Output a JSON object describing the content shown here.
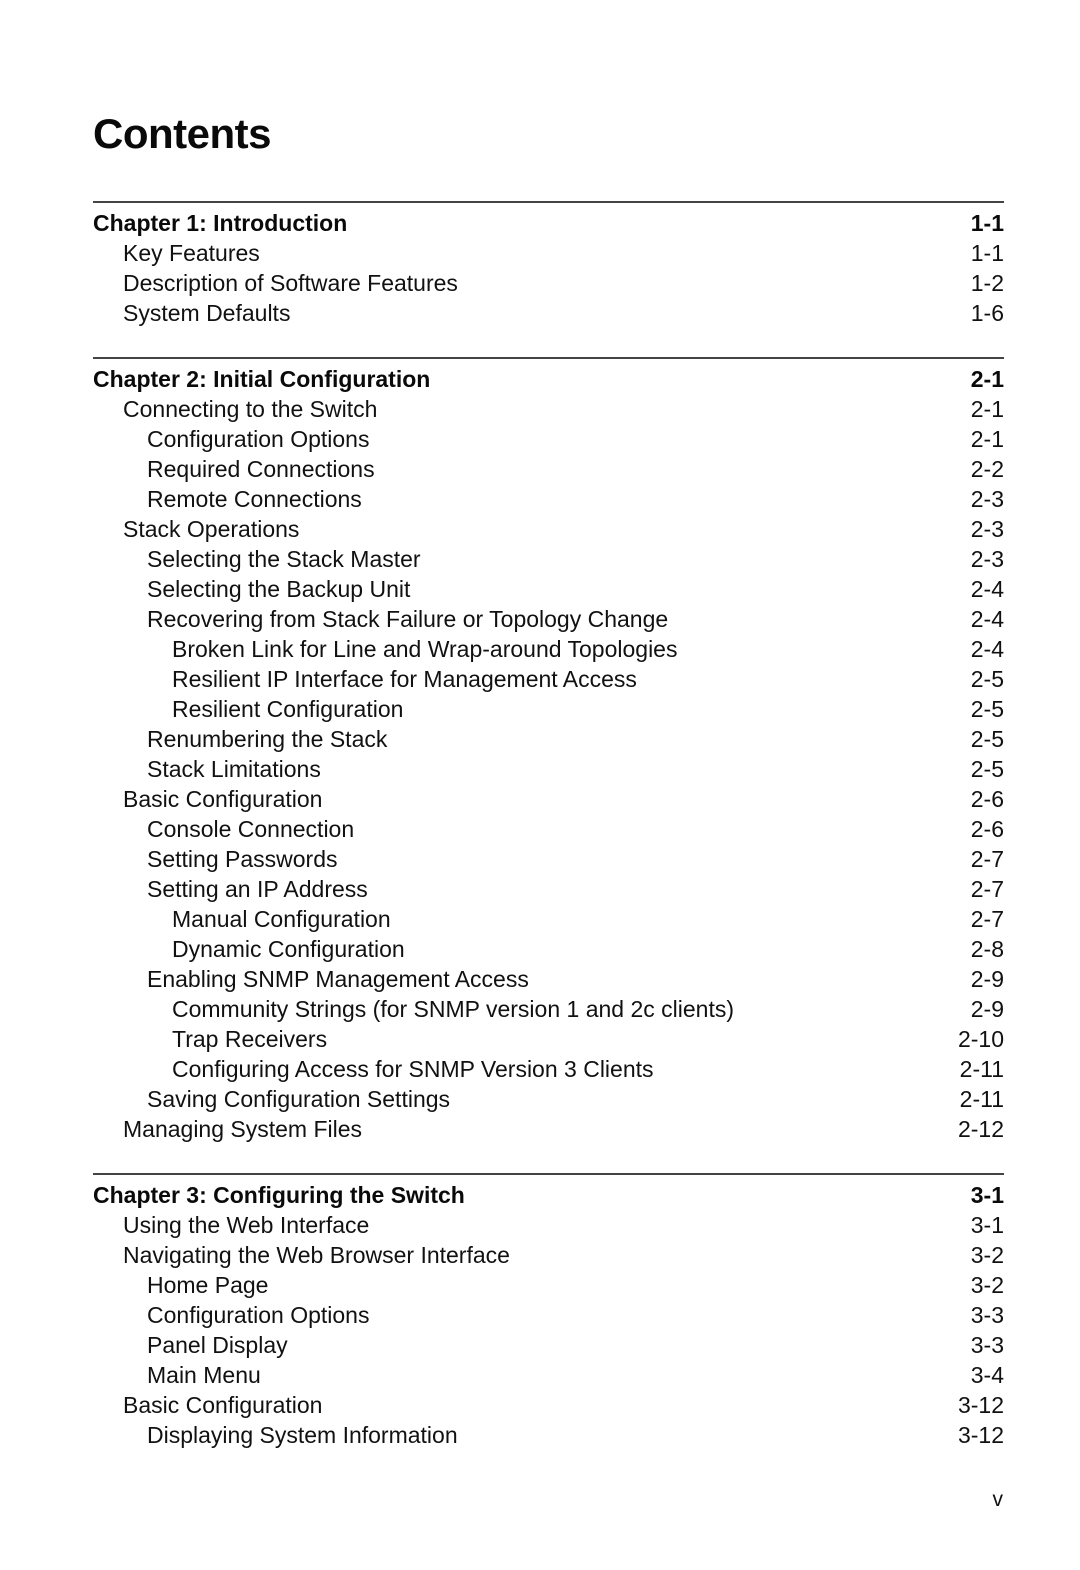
{
  "title": "Contents",
  "chapters": [
    {
      "heading": {
        "label": "Chapter 1: Introduction",
        "page": "1-1"
      },
      "entries": [
        {
          "level": 1,
          "label": "Key Features",
          "page": "1-1"
        },
        {
          "level": 1,
          "label": "Description of Software Features",
          "page": "1-2"
        },
        {
          "level": 1,
          "label": "System Defaults",
          "page": "1-6"
        }
      ]
    },
    {
      "heading": {
        "label": "Chapter 2: Initial Configuration",
        "page": "2-1"
      },
      "entries": [
        {
          "level": 1,
          "label": "Connecting to the Switch",
          "page": "2-1"
        },
        {
          "level": 2,
          "label": "Configuration Options",
          "page": "2-1"
        },
        {
          "level": 2,
          "label": "Required Connections",
          "page": "2-2"
        },
        {
          "level": 2,
          "label": "Remote Connections",
          "page": "2-3"
        },
        {
          "level": 1,
          "label": "Stack Operations",
          "page": "2-3"
        },
        {
          "level": 2,
          "label": "Selecting the Stack Master",
          "page": "2-3"
        },
        {
          "level": 2,
          "label": "Selecting the Backup Unit",
          "page": "2-4"
        },
        {
          "level": 2,
          "label": "Recovering from Stack Failure or Topology Change",
          "page": "2-4"
        },
        {
          "level": 3,
          "label": "Broken Link for Line and Wrap-around Topologies",
          "page": "2-4"
        },
        {
          "level": 3,
          "label": "Resilient IP Interface for Management Access",
          "page": "2-5"
        },
        {
          "level": 3,
          "label": "Resilient Configuration",
          "page": "2-5"
        },
        {
          "level": 2,
          "label": "Renumbering the Stack",
          "page": "2-5"
        },
        {
          "level": 2,
          "label": "Stack Limitations",
          "page": "2-5"
        },
        {
          "level": 1,
          "label": "Basic Configuration",
          "page": "2-6"
        },
        {
          "level": 2,
          "label": "Console Connection",
          "page": "2-6"
        },
        {
          "level": 2,
          "label": "Setting Passwords",
          "page": "2-7"
        },
        {
          "level": 2,
          "label": "Setting an IP Address",
          "page": "2-7"
        },
        {
          "level": 3,
          "label": "Manual Configuration",
          "page": "2-7"
        },
        {
          "level": 3,
          "label": "Dynamic Configuration",
          "page": "2-8"
        },
        {
          "level": 2,
          "label": "Enabling SNMP Management Access",
          "page": "2-9"
        },
        {
          "level": 3,
          "label": "Community Strings (for SNMP version 1 and 2c clients)",
          "page": "2-9"
        },
        {
          "level": 3,
          "label": "Trap Receivers",
          "page": "2-10"
        },
        {
          "level": 3,
          "label": "Configuring Access for SNMP Version 3 Clients",
          "page": "2-11"
        },
        {
          "level": 2,
          "label": "Saving Configuration Settings",
          "page": "2-11"
        },
        {
          "level": 1,
          "label": "Managing System Files",
          "page": "2-12"
        }
      ]
    },
    {
      "heading": {
        "label": "Chapter 3: Configuring the Switch",
        "page": "3-1"
      },
      "entries": [
        {
          "level": 1,
          "label": "Using the Web Interface",
          "page": "3-1"
        },
        {
          "level": 1,
          "label": "Navigating the Web Browser Interface",
          "page": "3-2"
        },
        {
          "level": 2,
          "label": "Home Page",
          "page": "3-2"
        },
        {
          "level": 2,
          "label": "Configuration Options",
          "page": "3-3"
        },
        {
          "level": 2,
          "label": "Panel Display",
          "page": "3-3"
        },
        {
          "level": 2,
          "label": "Main Menu",
          "page": "3-4"
        },
        {
          "level": 1,
          "label": "Basic Configuration",
          "page": "3-12"
        },
        {
          "level": 2,
          "label": "Displaying System Information",
          "page": "3-12"
        }
      ]
    }
  ],
  "footer": {
    "page_number": "v"
  }
}
